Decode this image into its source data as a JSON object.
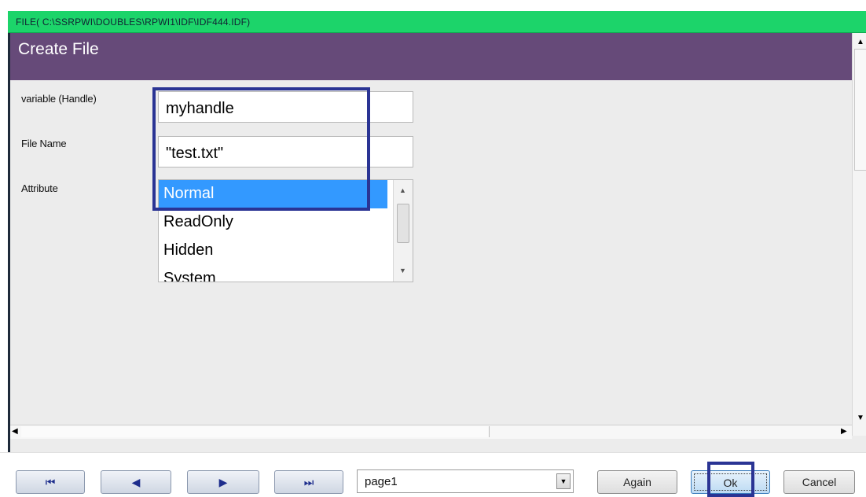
{
  "window": {
    "title": "FILE( C:\\SSRPWI\\DOUBLES\\RPWI1\\IDF\\IDF444.IDF)"
  },
  "form": {
    "heading": "Create File",
    "fields": {
      "variable_label": "variable (Handle)",
      "variable_value": "myhandle",
      "filename_label": "File Name",
      "filename_value": "\"test.txt\"",
      "attribute_label": "Attribute"
    },
    "attribute_options": [
      "Normal",
      "ReadOnly",
      "Hidden",
      "System"
    ],
    "attribute_selected": "Normal"
  },
  "colors": {
    "titlebar": "#1cd46a",
    "header": "#664a79",
    "selection": "#3399ff",
    "highlight_box": "#2a3494"
  },
  "icons": {
    "first": "first-page-icon",
    "prev": "previous-page-icon",
    "next": "next-page-icon",
    "last": "last-page-icon",
    "dropdown": "chevron-down-icon"
  },
  "navigation": {
    "page_value": "page1",
    "again_label": "Again",
    "ok_label": "Ok",
    "cancel_label": "Cancel"
  }
}
